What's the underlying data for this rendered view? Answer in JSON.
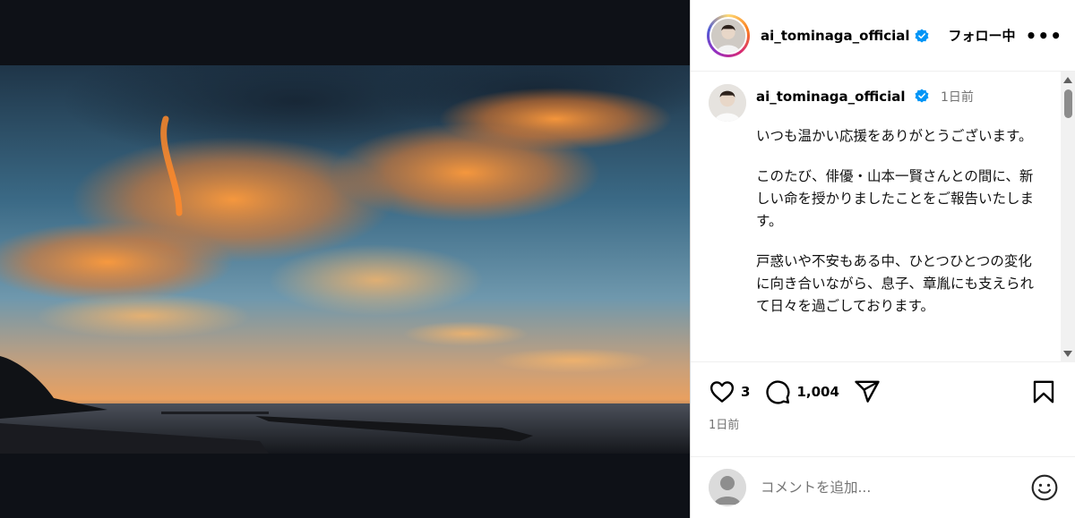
{
  "post": {
    "username": "ai_tominaga_official",
    "follow_label": "フォロー中",
    "more_label": "•••",
    "caption_time": "1日前",
    "caption_paragraphs": [
      "いつも温かい応援をありがとうございます。",
      "このたび、俳優・山本一賢さんとの間に、新しい命を授かりましたことをご報告いたします。",
      "戸惑いや不安もある中、ひとつひとつの変化に向き合いながら、息子、章胤にも支えられて日々を過ごしております。"
    ],
    "likes": "3",
    "comments": "1,004",
    "date": "1日前",
    "comment_placeholder": "コメントを追加..."
  },
  "icons": {
    "verified": "verified-badge-icon",
    "like": "heart-icon",
    "comment": "comment-bubble-icon",
    "share": "paper-plane-icon",
    "save": "bookmark-icon",
    "emoji": "emoji-smile-icon"
  },
  "colors": {
    "verified": "#0095f6",
    "text_secondary": "#737373"
  }
}
